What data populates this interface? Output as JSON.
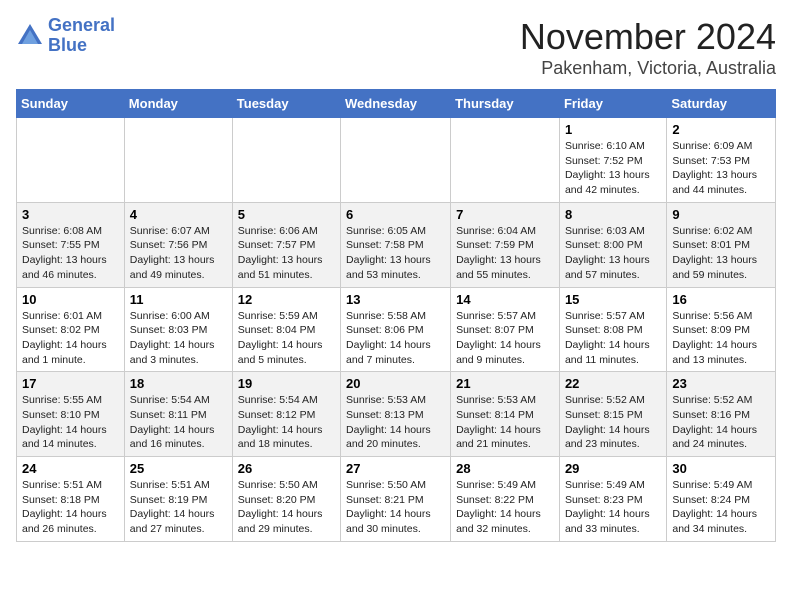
{
  "header": {
    "logo_line1": "General",
    "logo_line2": "Blue",
    "month": "November 2024",
    "location": "Pakenham, Victoria, Australia"
  },
  "weekdays": [
    "Sunday",
    "Monday",
    "Tuesday",
    "Wednesday",
    "Thursday",
    "Friday",
    "Saturday"
  ],
  "weeks": [
    [
      {
        "day": "",
        "info": ""
      },
      {
        "day": "",
        "info": ""
      },
      {
        "day": "",
        "info": ""
      },
      {
        "day": "",
        "info": ""
      },
      {
        "day": "",
        "info": ""
      },
      {
        "day": "1",
        "info": "Sunrise: 6:10 AM\nSunset: 7:52 PM\nDaylight: 13 hours\nand 42 minutes."
      },
      {
        "day": "2",
        "info": "Sunrise: 6:09 AM\nSunset: 7:53 PM\nDaylight: 13 hours\nand 44 minutes."
      }
    ],
    [
      {
        "day": "3",
        "info": "Sunrise: 6:08 AM\nSunset: 7:55 PM\nDaylight: 13 hours\nand 46 minutes."
      },
      {
        "day": "4",
        "info": "Sunrise: 6:07 AM\nSunset: 7:56 PM\nDaylight: 13 hours\nand 49 minutes."
      },
      {
        "day": "5",
        "info": "Sunrise: 6:06 AM\nSunset: 7:57 PM\nDaylight: 13 hours\nand 51 minutes."
      },
      {
        "day": "6",
        "info": "Sunrise: 6:05 AM\nSunset: 7:58 PM\nDaylight: 13 hours\nand 53 minutes."
      },
      {
        "day": "7",
        "info": "Sunrise: 6:04 AM\nSunset: 7:59 PM\nDaylight: 13 hours\nand 55 minutes."
      },
      {
        "day": "8",
        "info": "Sunrise: 6:03 AM\nSunset: 8:00 PM\nDaylight: 13 hours\nand 57 minutes."
      },
      {
        "day": "9",
        "info": "Sunrise: 6:02 AM\nSunset: 8:01 PM\nDaylight: 13 hours\nand 59 minutes."
      }
    ],
    [
      {
        "day": "10",
        "info": "Sunrise: 6:01 AM\nSunset: 8:02 PM\nDaylight: 14 hours\nand 1 minute."
      },
      {
        "day": "11",
        "info": "Sunrise: 6:00 AM\nSunset: 8:03 PM\nDaylight: 14 hours\nand 3 minutes."
      },
      {
        "day": "12",
        "info": "Sunrise: 5:59 AM\nSunset: 8:04 PM\nDaylight: 14 hours\nand 5 minutes."
      },
      {
        "day": "13",
        "info": "Sunrise: 5:58 AM\nSunset: 8:06 PM\nDaylight: 14 hours\nand 7 minutes."
      },
      {
        "day": "14",
        "info": "Sunrise: 5:57 AM\nSunset: 8:07 PM\nDaylight: 14 hours\nand 9 minutes."
      },
      {
        "day": "15",
        "info": "Sunrise: 5:57 AM\nSunset: 8:08 PM\nDaylight: 14 hours\nand 11 minutes."
      },
      {
        "day": "16",
        "info": "Sunrise: 5:56 AM\nSunset: 8:09 PM\nDaylight: 14 hours\nand 13 minutes."
      }
    ],
    [
      {
        "day": "17",
        "info": "Sunrise: 5:55 AM\nSunset: 8:10 PM\nDaylight: 14 hours\nand 14 minutes."
      },
      {
        "day": "18",
        "info": "Sunrise: 5:54 AM\nSunset: 8:11 PM\nDaylight: 14 hours\nand 16 minutes."
      },
      {
        "day": "19",
        "info": "Sunrise: 5:54 AM\nSunset: 8:12 PM\nDaylight: 14 hours\nand 18 minutes."
      },
      {
        "day": "20",
        "info": "Sunrise: 5:53 AM\nSunset: 8:13 PM\nDaylight: 14 hours\nand 20 minutes."
      },
      {
        "day": "21",
        "info": "Sunrise: 5:53 AM\nSunset: 8:14 PM\nDaylight: 14 hours\nand 21 minutes."
      },
      {
        "day": "22",
        "info": "Sunrise: 5:52 AM\nSunset: 8:15 PM\nDaylight: 14 hours\nand 23 minutes."
      },
      {
        "day": "23",
        "info": "Sunrise: 5:52 AM\nSunset: 8:16 PM\nDaylight: 14 hours\nand 24 minutes."
      }
    ],
    [
      {
        "day": "24",
        "info": "Sunrise: 5:51 AM\nSunset: 8:18 PM\nDaylight: 14 hours\nand 26 minutes."
      },
      {
        "day": "25",
        "info": "Sunrise: 5:51 AM\nSunset: 8:19 PM\nDaylight: 14 hours\nand 27 minutes."
      },
      {
        "day": "26",
        "info": "Sunrise: 5:50 AM\nSunset: 8:20 PM\nDaylight: 14 hours\nand 29 minutes."
      },
      {
        "day": "27",
        "info": "Sunrise: 5:50 AM\nSunset: 8:21 PM\nDaylight: 14 hours\nand 30 minutes."
      },
      {
        "day": "28",
        "info": "Sunrise: 5:49 AM\nSunset: 8:22 PM\nDaylight: 14 hours\nand 32 minutes."
      },
      {
        "day": "29",
        "info": "Sunrise: 5:49 AM\nSunset: 8:23 PM\nDaylight: 14 hours\nand 33 minutes."
      },
      {
        "day": "30",
        "info": "Sunrise: 5:49 AM\nSunset: 8:24 PM\nDaylight: 14 hours\nand 34 minutes."
      }
    ]
  ]
}
